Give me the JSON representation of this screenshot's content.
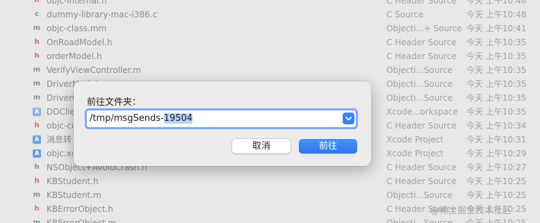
{
  "files": [
    {
      "icon": "header-file-icon",
      "glyph": "h",
      "type": "t-h",
      "name": "objc-internal.h",
      "kind": "C Header Source",
      "date": "今天 上午10:48"
    },
    {
      "icon": "c-source-file-icon",
      "glyph": "c",
      "type": "t-c",
      "name": "dummy-library-mac-i386.c",
      "kind": "C Source",
      "date": "今天 上午10:48"
    },
    {
      "icon": "objc-source-file-icon",
      "glyph": "m",
      "type": "t-m",
      "name": "objc-class.mm",
      "kind": "Objecti...+ Source",
      "date": "今天 上午10:41"
    },
    {
      "icon": "header-file-icon",
      "glyph": "h",
      "type": "t-h",
      "name": "OnRoadModel.h",
      "kind": "C Header Source",
      "date": "今天 上午10:35"
    },
    {
      "icon": "header-file-icon",
      "glyph": "h",
      "type": "t-h",
      "name": "orderModel.h",
      "kind": "C Header Source",
      "date": "今天 上午10:35"
    },
    {
      "icon": "objc-source-file-icon",
      "glyph": "m",
      "type": "t-m",
      "name": "VerifyViewController.m",
      "kind": "Objecti...Source",
      "date": "今天 上午10:35"
    },
    {
      "icon": "objc-source-file-icon",
      "glyph": "m",
      "type": "t-m",
      "name": "DriverModel.m",
      "kind": "Objecti...Source",
      "date": "今天 上午10:35"
    },
    {
      "icon": "objc-source-file-icon",
      "glyph": "m",
      "type": "t-m",
      "name": "DriverC",
      "kind": "Objecti...Source",
      "date": "今天 上午10:35"
    },
    {
      "icon": "xcode-workspace-icon",
      "glyph": "A",
      "type": "t-xc",
      "name": "DDClie",
      "kind": "Xcode...orkspace",
      "date": "今天 上午10:35"
    },
    {
      "icon": "header-file-icon",
      "glyph": "h",
      "type": "t-h",
      "name": "objc-co",
      "kind": "C Header Source",
      "date": "今天 上午10:34"
    },
    {
      "icon": "xcode-project-icon",
      "glyph": "A",
      "type": "t-proj",
      "name": "消息转",
      "kind": "Xcode Project",
      "date": "今天 上午10:31"
    },
    {
      "icon": "xcode-project-icon",
      "glyph": "A",
      "type": "t-proj",
      "name": "objc.xc",
      "kind": "Xcode Project",
      "date": "今天 上午10:29"
    },
    {
      "icon": "header-file-icon",
      "glyph": "h",
      "type": "t-h",
      "name": "NSObject+AvoidCrash.h",
      "kind": "C Header Source",
      "date": "今天 上午10:27"
    },
    {
      "icon": "header-file-icon",
      "glyph": "h",
      "type": "t-h",
      "name": "KBStudent.h",
      "kind": "C Header Source",
      "date": "今天 上午10:25"
    },
    {
      "icon": "objc-source-file-icon",
      "glyph": "m",
      "type": "t-m",
      "name": "KBStudent.m",
      "kind": "Objecti...Source",
      "date": "今天 上午10:25"
    },
    {
      "icon": "header-file-icon",
      "glyph": "h",
      "type": "t-h",
      "name": "KBErrorObject.h",
      "kind": "C Header Source",
      "date": "今天 上午10:25"
    },
    {
      "icon": "objc-source-file-icon",
      "glyph": "m",
      "type": "t-m",
      "name": "KBErrorObject.m",
      "kind": "Objecti...Source",
      "date": "今天 上午10:25"
    }
  ],
  "dialog": {
    "title": "前往文件夹：",
    "path_prefix": "/tmp/msgSends-",
    "path_selected": "19504",
    "cancel_label": "取消",
    "go_label": "前往"
  },
  "watermark": "@稀土掘金技术社区",
  "colors": {
    "accent": "#3d82f6",
    "focus_ring": "#7aa8f2",
    "selection": "#b7d3fb"
  }
}
